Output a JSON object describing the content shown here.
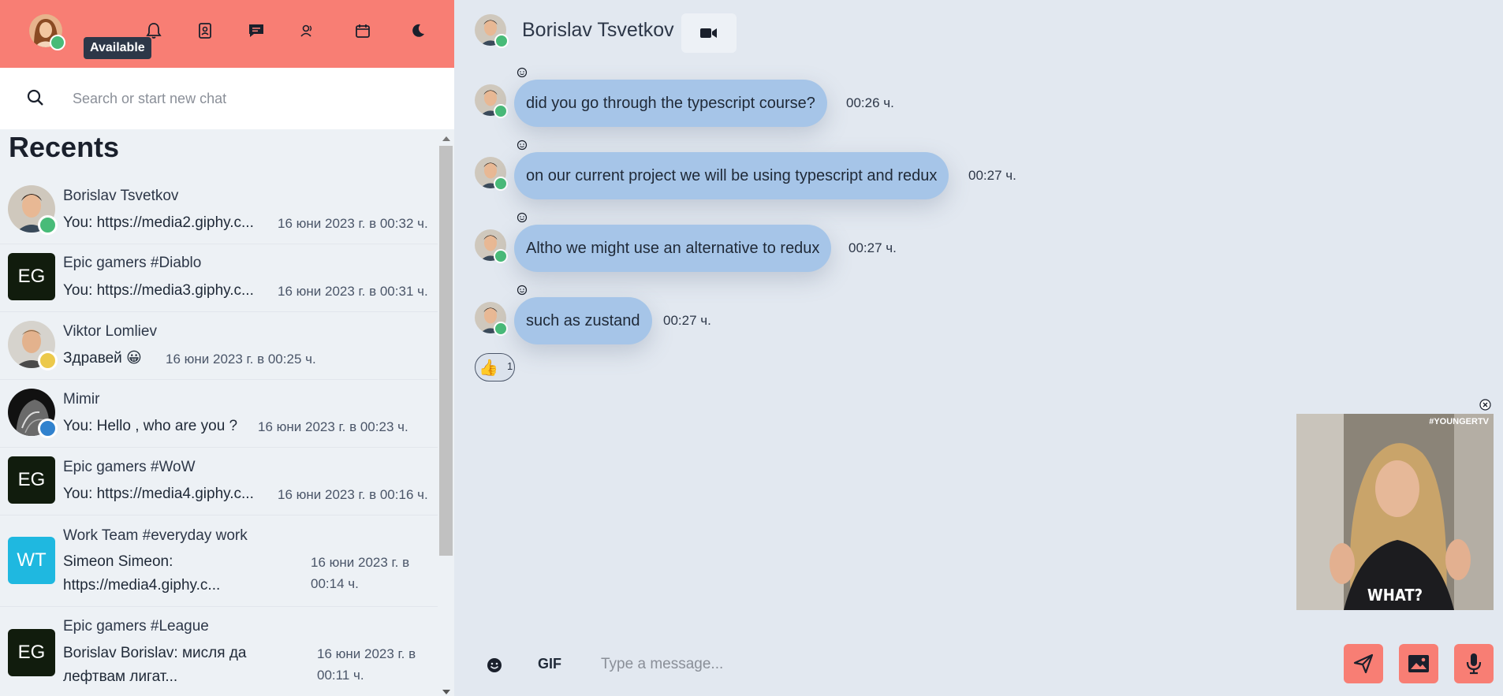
{
  "user": {
    "status_tooltip": "Available",
    "status_color": "#48bb78"
  },
  "colors": {
    "accent": "#f87e74",
    "bubble": "#a6c5e8",
    "online": "#48bb78",
    "away": "#ecc94b",
    "busy": "#3182ce"
  },
  "nav": [
    "bell-icon",
    "contacts-icon",
    "chat-icon",
    "group-icon",
    "calendar-icon",
    "moon-icon"
  ],
  "search": {
    "placeholder": "Search or start new chat"
  },
  "recents": {
    "title": "Recents",
    "items": [
      {
        "name": "Borislav Tsvetkov",
        "preview": "You: https://media2.giphy.c...",
        "time": "16 юни 2023 г. в 00:32 ч.",
        "status": "online"
      },
      {
        "name": "Epic gamers #Diablo",
        "initials": "EG",
        "preview": "You: https://media3.giphy.c...",
        "time": "16 юни 2023 г. в 00:31 ч."
      },
      {
        "name": "Viktor Lomliev",
        "preview": "Здравей 😀",
        "time": "16 юни 2023 г. в 00:25 ч.",
        "status": "away"
      },
      {
        "name": "Mimir",
        "preview": "You: Hello , who are you ?",
        "time": "16 юни 2023 г. в 00:23 ч.",
        "status": "busy"
      },
      {
        "name": "Epic gamers #WoW",
        "initials": "EG",
        "preview": "You: https://media4.giphy.c...",
        "time": "16 юни 2023 г. в 00:16 ч."
      },
      {
        "name": "Work Team #everyday work",
        "initials": "WT",
        "preview_l1": "Simeon Simeon:",
        "preview_l2": "https://media4.giphy.c...",
        "time_l1": "16 юни 2023 г. в",
        "time_l2": "00:14 ч."
      },
      {
        "name": "Epic gamers #League",
        "initials": "EG",
        "preview_l1": "Borislav Borislav: мисля да",
        "preview_l2": "лефтвам лигат...",
        "time_l1": "16 юни 2023 г. в",
        "time_l2": "00:11 ч."
      }
    ]
  },
  "conversation": {
    "contact_name": "Borislav Tsvetkov",
    "messages": [
      {
        "text": "did you go through the typescript course?",
        "time": "00:26 ч."
      },
      {
        "text": "on our current project we will be using typescript and redux",
        "time": "00:27 ч."
      },
      {
        "text": "Altho we might use an alternative to redux",
        "time": "00:27 ч."
      },
      {
        "text": "such as zustand",
        "time": "00:27 ч."
      }
    ],
    "reaction": {
      "emoji": "👍",
      "count": "1"
    },
    "gif_preview": {
      "watermark": "#YOUNGERTV",
      "caption": "WHAT?"
    }
  },
  "composer": {
    "gif_label": "GIF",
    "placeholder": "Type a message..."
  }
}
